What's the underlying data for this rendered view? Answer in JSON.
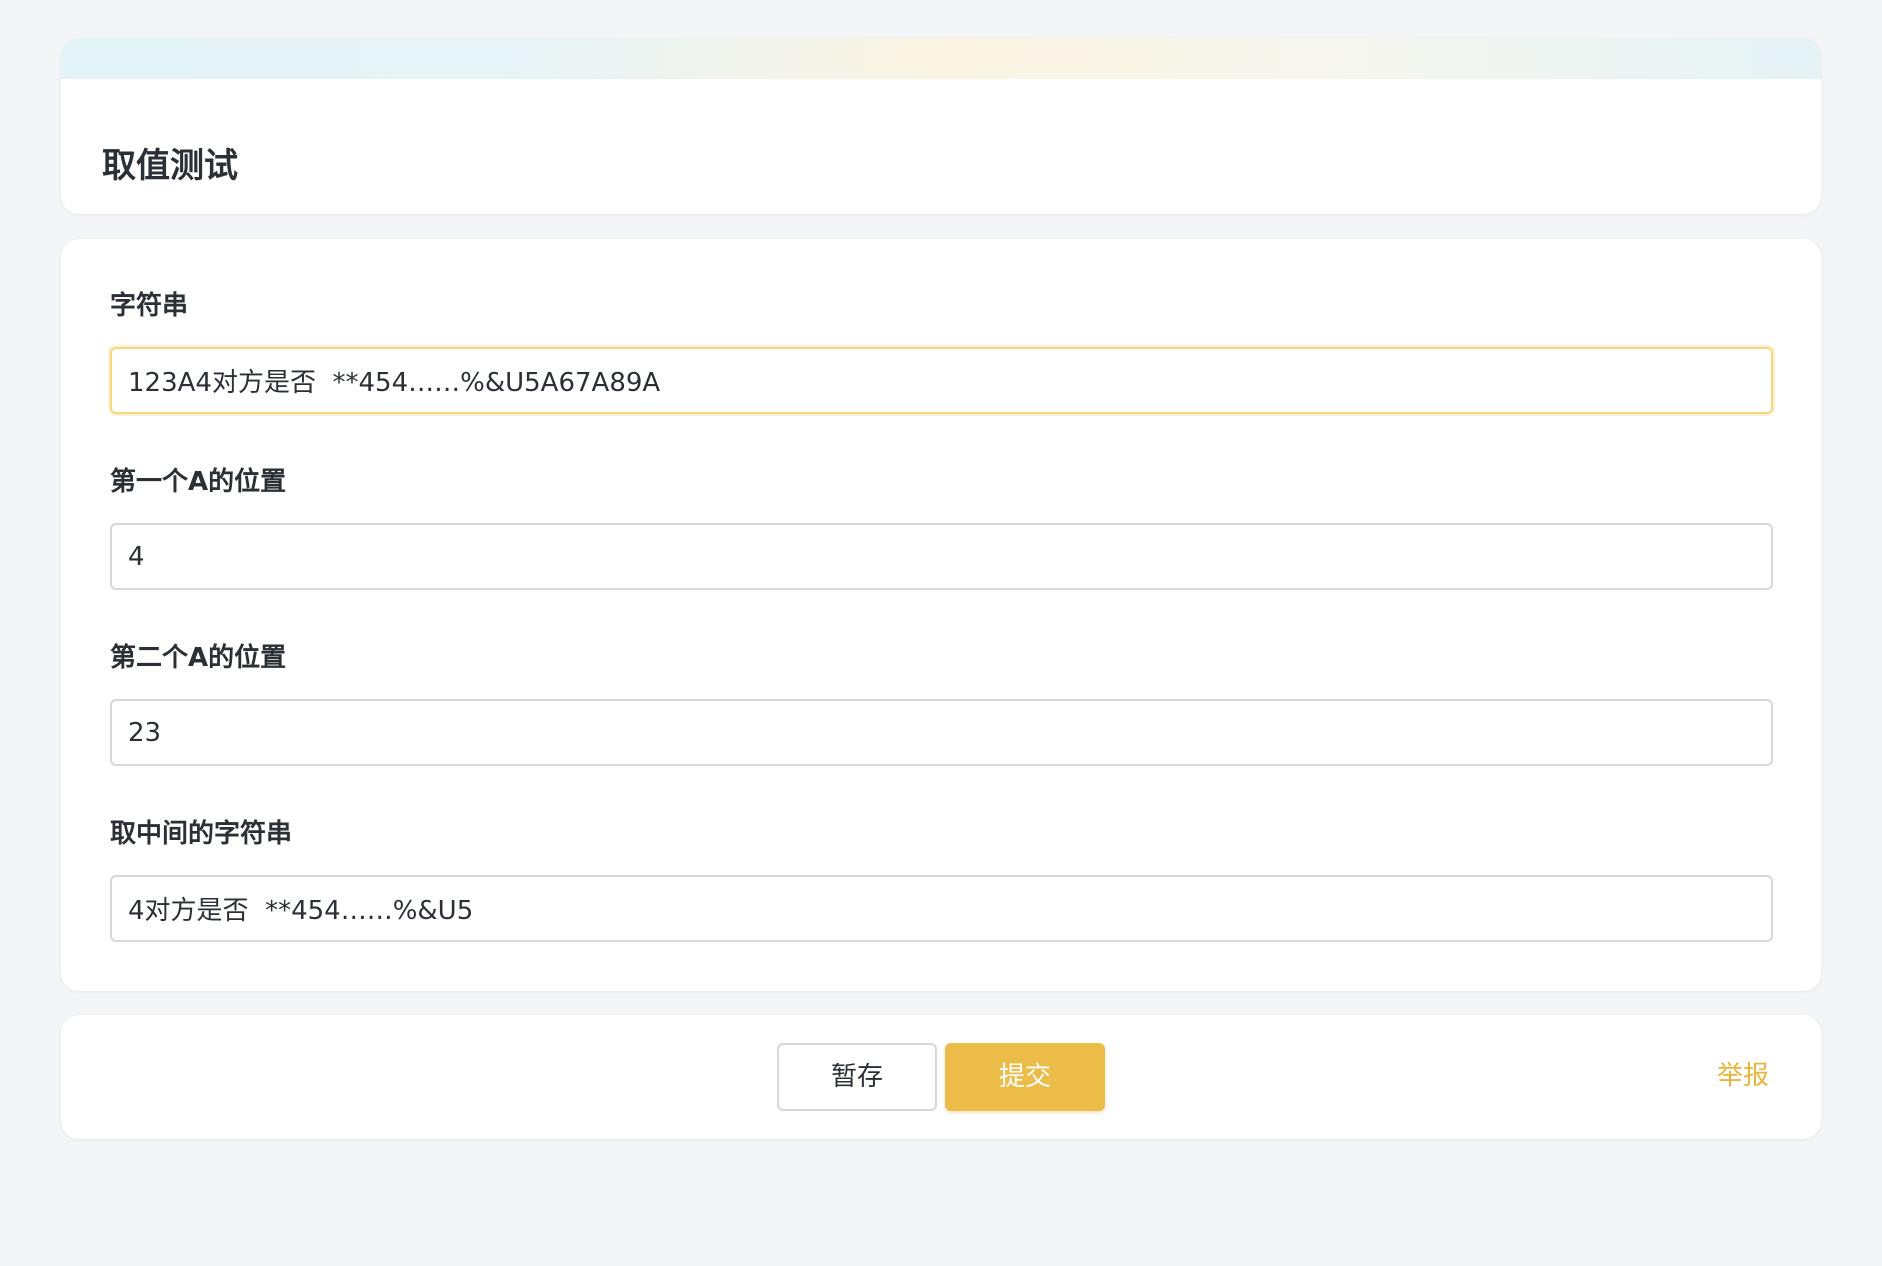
{
  "header": {
    "title": "取值测试"
  },
  "form": {
    "fields": [
      {
        "label": "字符串",
        "value": "123A4对方是否  **454……%&U5A67A89A"
      },
      {
        "label": "第一个A的位置",
        "value": "4"
      },
      {
        "label": "第二个A的位置",
        "value": "23"
      },
      {
        "label": "取中间的字符串",
        "value": "4对方是否  **454……%&U5"
      }
    ]
  },
  "footer": {
    "save_label": "暂存",
    "submit_label": "提交",
    "report_label": "举报"
  },
  "colors": {
    "accent": "#ebbd48",
    "report_link": "#e9b43c",
    "focus_border": "#f6d780",
    "background": "#f4f5f7"
  }
}
